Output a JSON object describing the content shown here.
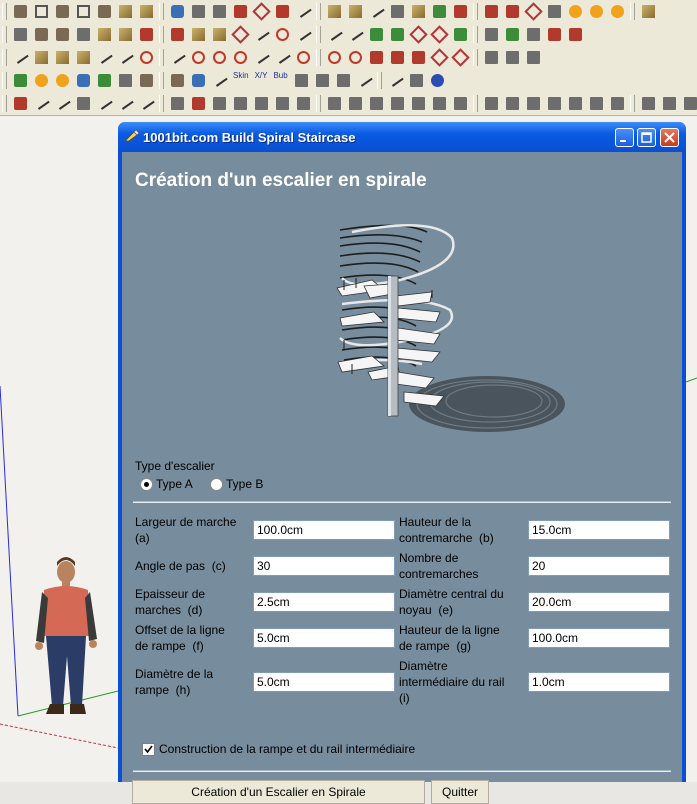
{
  "toolbar": {
    "skin_label": "Skin",
    "xy_label": "X/Y",
    "bub_label": "Bub"
  },
  "dialog": {
    "title": "1001bit.com Build Spiral Staircase",
    "heading": "Création d'un escalier en spirale",
    "type_label": "Type d'escalier",
    "radio_a": "Type A",
    "radio_b": "Type B",
    "selected_type": "Type A",
    "fields": {
      "a": {
        "label": "Largeur de marche\n(a)",
        "value": "100.0cm"
      },
      "b": {
        "label": "Hauteur de la\ncontremarche  (b)",
        "value": "15.0cm"
      },
      "c": {
        "label": "Angle de pas  (c)",
        "value": "30"
      },
      "n": {
        "label": "Nombre de\ncontremarches",
        "value": "20"
      },
      "d": {
        "label": "Epaisseur de\nmarches  (d)",
        "value": "2.5cm"
      },
      "e": {
        "label": "Diamètre central du\nnoyau  (e)",
        "value": "20.0cm"
      },
      "f": {
        "label": "Offset de la ligne\nde rampe  (f)",
        "value": "5.0cm"
      },
      "g": {
        "label": "Hauteur de la ligne\nde rampe  (g)",
        "value": "100.0cm"
      },
      "h": {
        "label": "Diamètre de la\nrampe  (h)",
        "value": "5.0cm"
      },
      "i": {
        "label": "Diamètre\nintermédiaire du rail\n(i)",
        "value": "1.0cm"
      }
    },
    "checkbox_label": "Construction de la rampe et du rail intermédiaire",
    "checkbox_checked": true,
    "create_button": "Création d'un Escalier en Spirale",
    "quit_button": "Quitter"
  },
  "colors": {
    "client_bg": "#778c9c",
    "titlebar": "#0a5ae3",
    "close_button": "#c33c1d"
  }
}
